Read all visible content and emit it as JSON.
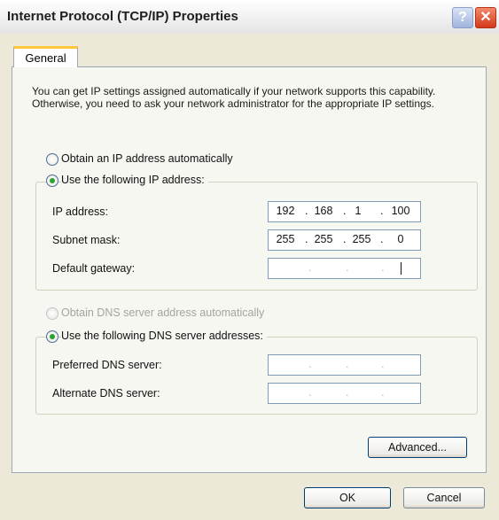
{
  "window": {
    "title": "Internet Protocol (TCP/IP) Properties",
    "help_glyph": "?",
    "close_glyph": "✕"
  },
  "tabs": [
    {
      "label": "General",
      "selected": true
    }
  ],
  "description": "You can get IP settings assigned automatically if your network supports this capability. Otherwise, you need to ask your network administrator for the appropriate IP settings.",
  "ip": {
    "auto_label": "Obtain an IP address automatically",
    "manual_label": "Use the following IP address:",
    "selected": "manual",
    "fields": [
      {
        "label": "IP address:",
        "octets": [
          "192",
          "168",
          "1",
          "100"
        ]
      },
      {
        "label": "Subnet mask:",
        "octets": [
          "255",
          "255",
          "255",
          "0"
        ]
      },
      {
        "label": "Default gateway:",
        "octets": [
          "",
          "",
          "",
          ""
        ]
      }
    ]
  },
  "dns": {
    "auto_label": "Obtain DNS server address automatically",
    "manual_label": "Use the following DNS server addresses:",
    "selected": "manual",
    "auto_disabled": true,
    "fields": [
      {
        "label": "Preferred DNS server:",
        "octets": [
          "",
          "",
          "",
          ""
        ]
      },
      {
        "label": "Alternate DNS server:",
        "octets": [
          "",
          "",
          "",
          ""
        ]
      }
    ]
  },
  "buttons": {
    "advanced": "Advanced...",
    "ok": "OK",
    "cancel": "Cancel"
  }
}
